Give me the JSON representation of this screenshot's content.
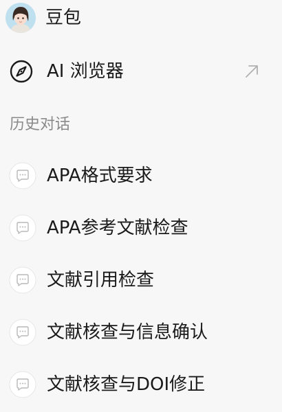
{
  "header": {
    "app_name": "豆包"
  },
  "browser": {
    "label": "AI 浏览器"
  },
  "history": {
    "title": "历史对话",
    "items": [
      {
        "label": "APA格式要求"
      },
      {
        "label": "APA参考文献检查"
      },
      {
        "label": "文献引用检查"
      },
      {
        "label": "文献核查与信息确认"
      },
      {
        "label": "文献核查与DOI修正"
      }
    ]
  },
  "icons": {
    "avatar": "avatar",
    "browser": "compass-icon",
    "open": "arrow-up-right-icon",
    "chat": "chat-bubble-icon"
  }
}
